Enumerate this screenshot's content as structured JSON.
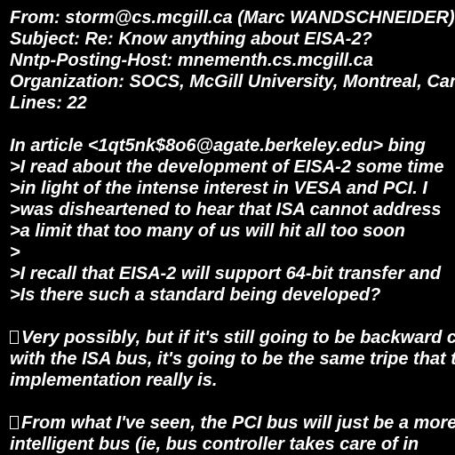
{
  "document": {
    "header": {
      "from": "From: storm@cs.mcgill.ca (Marc WANDSCHNEIDER)",
      "subject": "Subject: Re: Know anything about EISA-2?",
      "nntp_host": "Nntp-Posting-Host: mnementh.cs.mcgill.ca",
      "organization": "Organization: SOCS, McGill University, Montreal, Canada",
      "lines": "Lines: 22"
    },
    "quote": {
      "attribution": "In article <1qt5nk$8o6@agate.berkeley.edu> bing",
      "lines": [
        ">I read about the development of EISA-2 some time",
        ">in light of the intense interest in VESA and PCI. I",
        ">was disheartened to hear that ISA cannot address",
        ">a limit that too many of us will hit all too soon",
        ">",
        ">I recall that EISA-2 will support 64-bit transfer and",
        ">Is there such a standard being developed?"
      ]
    },
    "reply_1": {
      "lines": [
        "Very possibly, but if it's still going to be backward compatible",
        "with the ISA bus, it's going to be the same tripe that the",
        "implementation really is."
      ]
    },
    "reply_2": {
      "lines": [
        "From what I've seen, the PCI bus will just be a more",
        "intelligent bus (ie, bus controller takes care of in"
      ]
    }
  }
}
